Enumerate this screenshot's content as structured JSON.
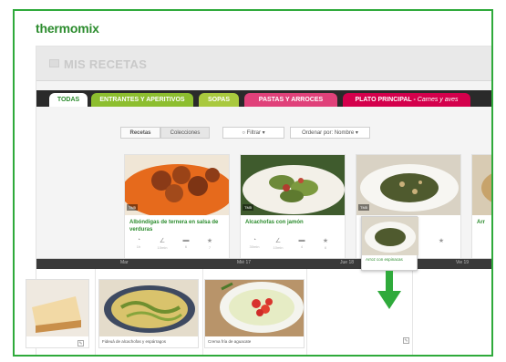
{
  "brand": {
    "logo_text": "thermomix"
  },
  "page": {
    "title": "MIS RECETAS"
  },
  "tabs": [
    {
      "label": "TODAS"
    },
    {
      "label": "ENTRANTES Y APERITIVOS"
    },
    {
      "label": "SOPAS"
    },
    {
      "label": "PASTAS Y ARROCES"
    },
    {
      "label": "PLATO PRINCIPAL - ",
      "sub": "Carnes y aves"
    }
  ],
  "filters": {
    "recetas": "Recetas",
    "colecciones": "Colecciones",
    "filtrar": "Filtrar",
    "ordenar": "Ordenar por: Nombre"
  },
  "recipes": [
    {
      "title": "Albóndigas de ternera en salsa de verduras",
      "badge": "TM5",
      "meta": [
        "1h",
        "10min",
        "6",
        "7"
      ]
    },
    {
      "title": "Alcachofas con jamón",
      "badge": "TM5",
      "meta": [
        "30min",
        "10min",
        "4",
        "6"
      ]
    },
    {
      "title": "Arroz con espinacas",
      "badge": "TM5",
      "meta": []
    },
    {
      "title": "Arr",
      "badge": "",
      "meta": []
    }
  ],
  "calendar": {
    "days": [
      "Mar",
      "Mié 17",
      "Jue 18",
      "Vie 19"
    ],
    "items": [
      {
        "label": "Fideuá de alcachofas y espárragos"
      },
      {
        "label": "Crema fría de aguacate"
      }
    ]
  },
  "drag": {
    "label": "Arroz con espinacas"
  },
  "colors": {
    "accent": "#2c8c2e",
    "frame": "#2faa3b",
    "pink": "#e0417a",
    "red": "#d4004c",
    "lime": "#8dbe2f"
  }
}
